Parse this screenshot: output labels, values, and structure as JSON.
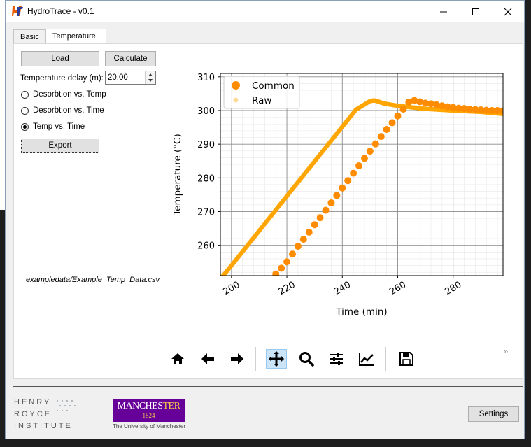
{
  "window": {
    "title": "HydroTrace - v0.1"
  },
  "tabs": [
    {
      "label": "Basic",
      "active": false
    },
    {
      "label": "Temperature",
      "active": true
    }
  ],
  "controls": {
    "load_label": "Load",
    "calculate_label": "Calculate",
    "delay_label": "Temperature delay (m):",
    "delay_value": "20.00",
    "radios": [
      {
        "label": "Desorbtion vs. Temp",
        "checked": false
      },
      {
        "label": "Desorbtion vs. Time",
        "checked": false
      },
      {
        "label": "Temp vs. Time",
        "checked": true
      }
    ],
    "export_label": "Export",
    "file_path": "exampledata/Example_Temp_Data.csv"
  },
  "toolbar": {
    "icons": [
      "home-icon",
      "back-arrow-icon",
      "forward-arrow-icon",
      "pan-icon",
      "zoom-icon",
      "configure-subplots-icon",
      "edit-axis-icon",
      "save-icon"
    ],
    "active": "pan-icon",
    "overflow": "»"
  },
  "footer": {
    "henry_royce_lines": [
      "HENRY",
      "ROYCE",
      "INSTITUTE"
    ],
    "manchester_name_a": "MANCHES",
    "manchester_name_b": "TER",
    "manchester_year": "1824",
    "manchester_sub": "The University of Manchester",
    "settings_label": "Settings"
  },
  "colors": {
    "series": "#ff8c00",
    "raw": "#ffa500",
    "manchester_purple": "#660099",
    "manchester_gold": "#f2c94c"
  },
  "chart_data": {
    "type": "scatter",
    "xlabel": "Time (min)",
    "ylabel": "Temperature (°C)",
    "xlim": [
      196,
      298
    ],
    "ylim": [
      251,
      311
    ],
    "xticks": [
      200,
      220,
      240,
      260,
      280
    ],
    "yticks": [
      260,
      270,
      280,
      290,
      300,
      310
    ],
    "grid": true,
    "legend_position": "top-left",
    "series": [
      {
        "name": "Common",
        "x": [
          216.0,
          218.0,
          220.0,
          222.0,
          224.0,
          226.0,
          228.0,
          230.0,
          232.0,
          234.0,
          236.0,
          238.0,
          240.0,
          242.0,
          244.0,
          246.0,
          248.0,
          250.0,
          252.0,
          254.0,
          256.0,
          258.0,
          260.0,
          262.0,
          264.0,
          266.0,
          268.0,
          270.0,
          272.0,
          274.0,
          276.0,
          278.0,
          280.0,
          282.0,
          284.0,
          286.0,
          288.0,
          290.0,
          292.0,
          294.0,
          296.0,
          298.0
        ],
        "y": [
          251.5,
          253.2,
          255.1,
          257.4,
          259.7,
          261.8,
          263.9,
          266.1,
          268.2,
          270.4,
          272.6,
          274.8,
          277.0,
          279.2,
          281.4,
          283.6,
          285.8,
          287.9,
          290.1,
          292.3,
          294.4,
          296.4,
          298.4,
          300.4,
          302.5,
          303.0,
          302.6,
          302.2,
          302.0,
          301.7,
          301.4,
          301.1,
          300.9,
          300.7,
          300.6,
          300.4,
          300.3,
          300.2,
          300.1,
          300.0,
          300.0,
          299.9
        ]
      },
      {
        "name": "Raw",
        "x": [
          196.0,
          200.0,
          210.0,
          220.0,
          230.0,
          240.0,
          245.0,
          250.0,
          251.5,
          252.5,
          255.0,
          260.0,
          270.0,
          280.0,
          290.0,
          298.0
        ],
        "y": [
          250.0,
          254.0,
          264.3,
          274.6,
          284.9,
          295.2,
          300.3,
          302.8,
          303.0,
          302.8,
          302.1,
          301.4,
          300.5,
          300.0,
          299.6,
          299.0
        ]
      }
    ]
  }
}
